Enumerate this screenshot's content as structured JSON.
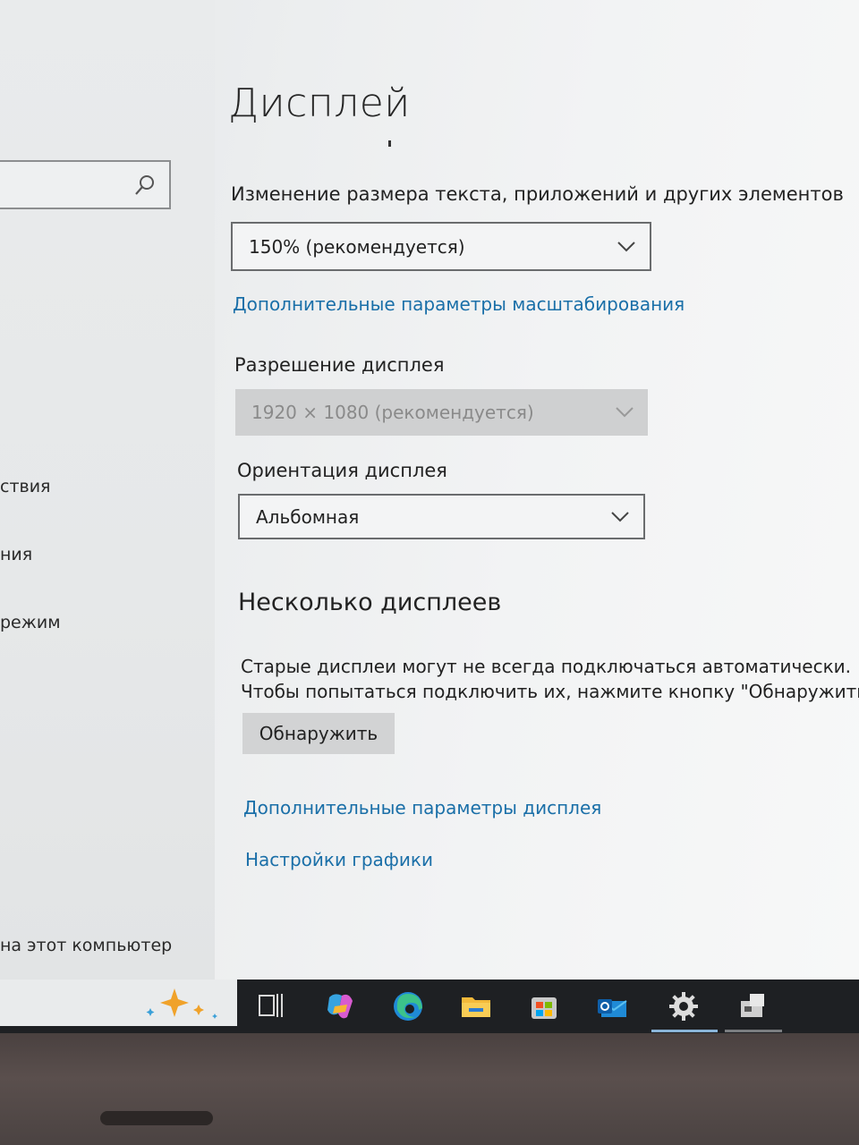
{
  "sidebar": {
    "search": {
      "placeholder": ""
    },
    "items": [
      {
        "label": "ствия"
      },
      {
        "label": "ния"
      },
      {
        "label": "режим"
      },
      {
        "label": "на этот компьютер"
      }
    ]
  },
  "page": {
    "title": "Дисплей"
  },
  "scale": {
    "label": "Изменение размера текста, приложений и других элементов",
    "value": "150% (рекомендуется)",
    "advanced_link": "Дополнительные параметры масштабирования"
  },
  "resolution": {
    "label": "Разрешение дисплея",
    "value": "1920 × 1080 (рекомендуется)"
  },
  "orientation": {
    "label": "Ориентация дисплея",
    "value": "Альбомная"
  },
  "multiple_displays": {
    "title": "Несколько дисплеев",
    "description_line1": "Старые дисплеи могут не всегда подключаться автоматически.",
    "description_line2": "Чтобы попытаться подключить их, нажмите кнопку \"Обнаружить\".",
    "detect_button": "Обнаружить",
    "advanced_display_link": "Дополнительные параметры дисплея",
    "graphics_link": "Настройки графики"
  },
  "taskbar": {
    "icons": [
      "copilot-sparkle-icon",
      "task-view-icon",
      "copilot-icon",
      "edge-icon",
      "file-explorer-icon",
      "store-icon",
      "outlook-icon",
      "settings-icon",
      "app-icon"
    ]
  },
  "colors": {
    "link": "#1a6fa8",
    "taskbar": "#1e2023",
    "disabled_select": "#cfd0d1"
  }
}
